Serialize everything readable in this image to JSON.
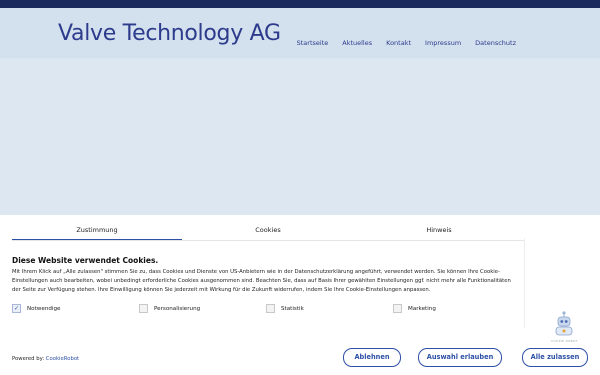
{
  "header": {
    "brand": "Valve Technology AG",
    "nav": [
      "Startseite",
      "Aktuelles",
      "Kontakt",
      "Impressum",
      "Datenschutz"
    ]
  },
  "consent": {
    "tabs": [
      "Zustimmung",
      "Cookies",
      "Hinweis"
    ],
    "active_tab": "Zustimmung",
    "title": "Diese Website verwendet Cookies.",
    "text": "Mit Ihrem Klick auf „Alle zulassen\" stimmen Sie zu, dass Cookies und Dienste von US-Anbietern wie in der Datenschutzerklärung angeführt, verwendet werden. Sie können Ihre Cookie-Einstellungen auch bearbeiten, wobei unbedingt erforderliche Cookies ausgenommen sind. Beachten Sie, dass auf Basis Ihrer gewählten Einstellungen ggf. nicht mehr alle Funktionalitäten der Seite zur Verfügung stehen. Ihre Einwilligung können Sie jederzeit mit Wirkung für die Zukunft widerrufen, indem Sie Ihre Cookie-Einstellungen anpassen.",
    "checkboxes": [
      {
        "label": "Notwendige",
        "checked": true
      },
      {
        "label": "Personalisierung",
        "checked": false
      },
      {
        "label": "Statistik",
        "checked": false
      },
      {
        "label": "Marketing",
        "checked": false
      }
    ],
    "powered_prefix": "Powered by:",
    "powered_link": "CookieRobot",
    "buttons": {
      "reject": "Ablehnen",
      "allow_selection": "Auswahl erlauben",
      "allow_all": "Alle zulassen"
    },
    "accent_color": "#2d4fa6"
  }
}
